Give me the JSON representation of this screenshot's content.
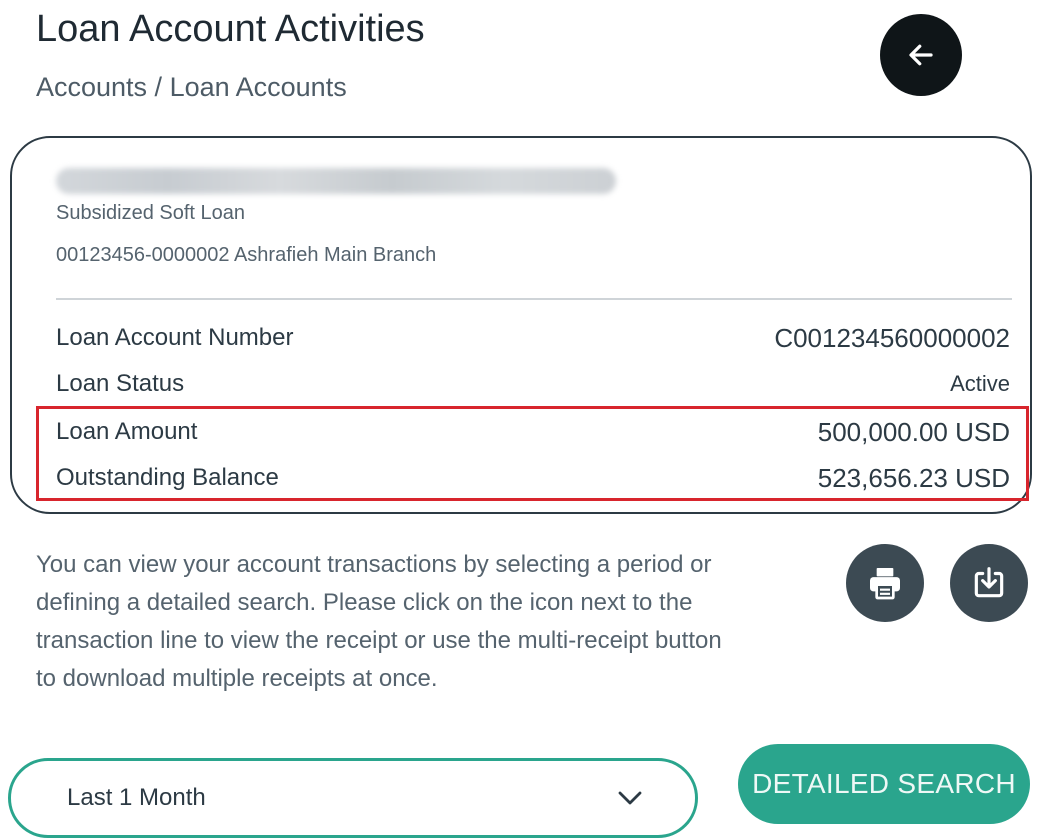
{
  "header": {
    "title": "Loan Account Activities",
    "breadcrumb": "Accounts / Loan Accounts"
  },
  "account": {
    "type": "Subsidized Soft Loan",
    "branch_line": "00123456-0000002 Ashrafieh Main Branch",
    "details": [
      {
        "label": "Loan Account Number",
        "value": "C001234560000002"
      },
      {
        "label": "Loan Status",
        "value": "Active"
      },
      {
        "label": "Loan Amount",
        "value": "500,000.00 USD"
      },
      {
        "label": "Outstanding Balance",
        "value": "523,656.23 USD"
      }
    ]
  },
  "info_text": "You can view your account transactions by selecting a period or defining a detailed search. Please click on the icon next to the transaction line to view the receipt or use the multi-receipt button to download multiple receipts at once.",
  "actions": {
    "print_icon": "printer-icon",
    "download_icon": "download-icon"
  },
  "filter": {
    "period_selected": "Last 1 Month",
    "detailed_search_label": "DETAILED SEARCH"
  },
  "colors": {
    "accent": "#2aa58d",
    "highlight": "#d8252d",
    "dark_button": "#3c4a53"
  }
}
